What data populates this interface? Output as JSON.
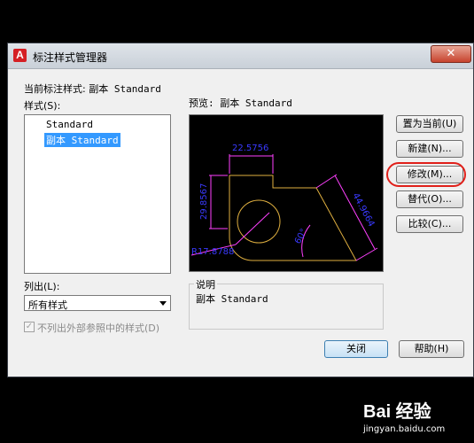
{
  "window": {
    "title": "标注样式管理器",
    "close_glyph": "✕",
    "app_icon_letter": "A"
  },
  "current_style": {
    "label": "当前标注样式:",
    "value": "副本 Standard"
  },
  "styles": {
    "label": "样式(S):",
    "items": [
      "Standard",
      "副本 Standard"
    ],
    "selected_index": 1
  },
  "preview": {
    "label": "预览: 副本 Standard",
    "dims": {
      "top": "22.5756",
      "left": "29.8567",
      "radius": "R17.8788",
      "diag": "44.9664",
      "angle": "60°"
    }
  },
  "list_filter": {
    "label": "列出(L):",
    "value": "所有样式"
  },
  "checkbox": {
    "label": "不列出外部参照中的样式(D)",
    "checked": true,
    "enabled": false
  },
  "description": {
    "label": "说明",
    "text": "副本 Standard"
  },
  "buttons": {
    "set_current": "置为当前(U)",
    "new": "新建(N)...",
    "modify": "修改(M)...",
    "override": "替代(O)...",
    "compare": "比较(C)...",
    "close": "关闭",
    "help": "帮助(H)"
  },
  "watermark": {
    "text": "Bai 经验",
    "sub": "jingyan.baidu.com"
  },
  "colors": {
    "dim": "#3a3aff",
    "geometry": "#e0b040",
    "selection": "#3399ff",
    "highlight": "#e0201a"
  }
}
